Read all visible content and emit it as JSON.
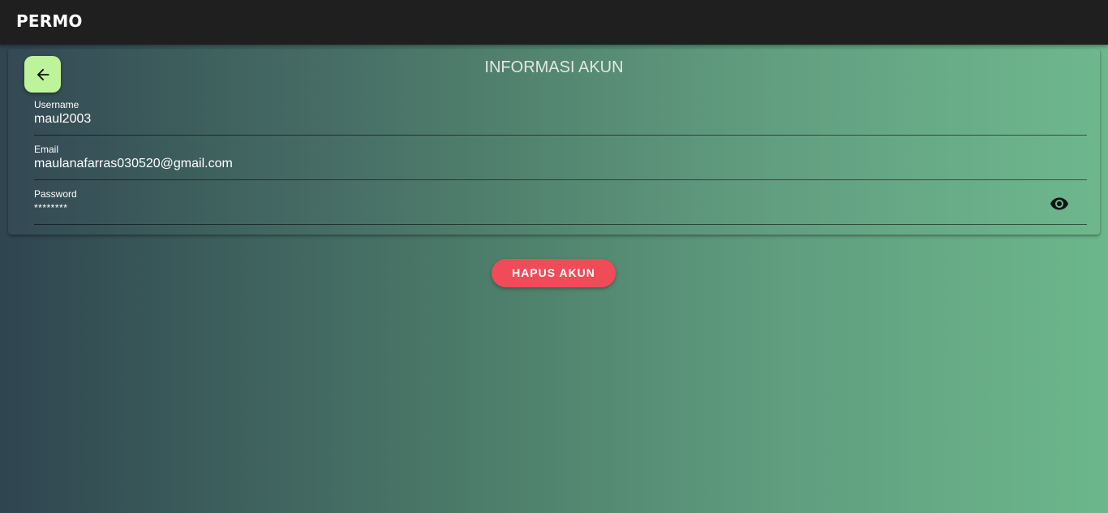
{
  "app": {
    "brand": "PERMO"
  },
  "card": {
    "title": "INFORMASI AKUN",
    "back_icon": "arrow-left-icon",
    "fields": [
      {
        "label": "Username",
        "value": "maul2003"
      },
      {
        "label": "Email",
        "value": "maulanafarras030520@gmail.com"
      },
      {
        "label": "Password",
        "value": "********",
        "toggle_icon": "eye-icon"
      }
    ]
  },
  "actions": {
    "delete_label": "HAPUS AKUN"
  },
  "colors": {
    "topbar": "#1f1f1f",
    "back_button": "#bdf39b",
    "delete_button": "#f04b58",
    "gradient_start": "#2f4550",
    "gradient_end": "#6cb78c"
  }
}
